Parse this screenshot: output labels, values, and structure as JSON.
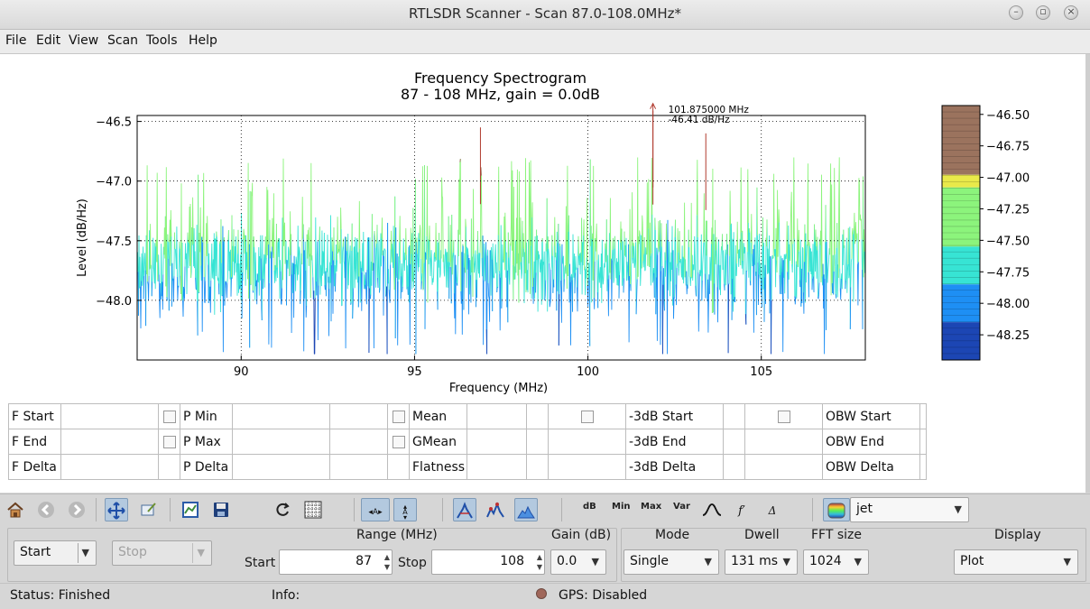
{
  "window": {
    "title": "RTLSDR Scanner - Scan 87.0-108.0MHz*"
  },
  "menu": [
    "File",
    "Edit",
    "View",
    "Scan",
    "Tools",
    "Help"
  ],
  "chart_data": {
    "type": "line",
    "title": "Frequency Spectrogram",
    "subtitle": "87 - 108 MHz, gain = 0.0dB",
    "xlabel": "Frequency (MHz)",
    "ylabel": "Level (dB/Hz)",
    "xlim": [
      87,
      108
    ],
    "ylim": [
      -48.5,
      -46.45
    ],
    "xticks": [
      90,
      95,
      100,
      105
    ],
    "xtick_labels": [
      "90",
      "95",
      "100",
      "105"
    ],
    "yticks": [
      -46.5,
      -47.0,
      -47.5,
      -48.0
    ],
    "ytick_labels": [
      "−46.5",
      "−47.0",
      "−47.5",
      "−48.0"
    ],
    "grid": true,
    "series": [
      {
        "description": "dense noise floor spectrum, colour-mapped by level",
        "baseline_mean": -47.7,
        "peak_markers": [
          {
            "x": 96.9,
            "y": -46.55
          },
          {
            "x": 101.875,
            "y": -46.41
          },
          {
            "x": 103.4,
            "y": -46.6
          }
        ]
      }
    ],
    "annotation": {
      "x": 101.875,
      "y": -46.41,
      "line1": "101.875000 MHz",
      "line2": "-46.41 dB/Hz"
    },
    "colorbar": {
      "range": [
        -48.45,
        -46.43
      ],
      "ticks": [
        -46.5,
        -46.75,
        -47.0,
        -47.25,
        -47.5,
        -47.75,
        -48.0,
        -48.25
      ],
      "tick_labels": [
        "−46.50",
        "−46.75",
        "−47.00",
        "−47.25",
        "−47.50",
        "−47.75",
        "−48.00",
        "−48.25"
      ],
      "colors": [
        "#1a2a5c",
        "#1c46b4",
        "#1e8ff4",
        "#37e4d4",
        "#8cf47c",
        "#9b735e"
      ]
    }
  },
  "measurements": {
    "rows": [
      [
        "F Start",
        "P Min",
        "Mean",
        "-3dB Start",
        "OBW Start"
      ],
      [
        "F End",
        "P Max",
        "GMean",
        "-3dB End",
        "OBW End"
      ],
      [
        "F Delta",
        "P Delta",
        "Flatness",
        "-3dB Delta",
        "OBW Delta"
      ]
    ]
  },
  "toolbar": {
    "text_buttons": [
      "dB",
      "Min",
      "Max",
      "Var"
    ],
    "colormap": "jet"
  },
  "controls": {
    "start_button": "Start",
    "stop_button": "Stop",
    "range_label": "Range (MHz)",
    "start_label": "Start",
    "start_value": "87",
    "stop_label": "Stop",
    "stop_value": "108",
    "gain_label": "Gain (dB)",
    "gain_value": "0.0",
    "mode_label": "Mode",
    "mode_value": "Single",
    "dwell_label": "Dwell",
    "dwell_value": "131 ms",
    "fft_label": "FFT size",
    "fft_value": "1024",
    "display_label": "Display",
    "display_value": "Plot"
  },
  "status": {
    "status_text": "Status: Finished",
    "info_text": "Info:",
    "gps_text": "GPS: Disabled",
    "gps_color": "#a0675a"
  }
}
